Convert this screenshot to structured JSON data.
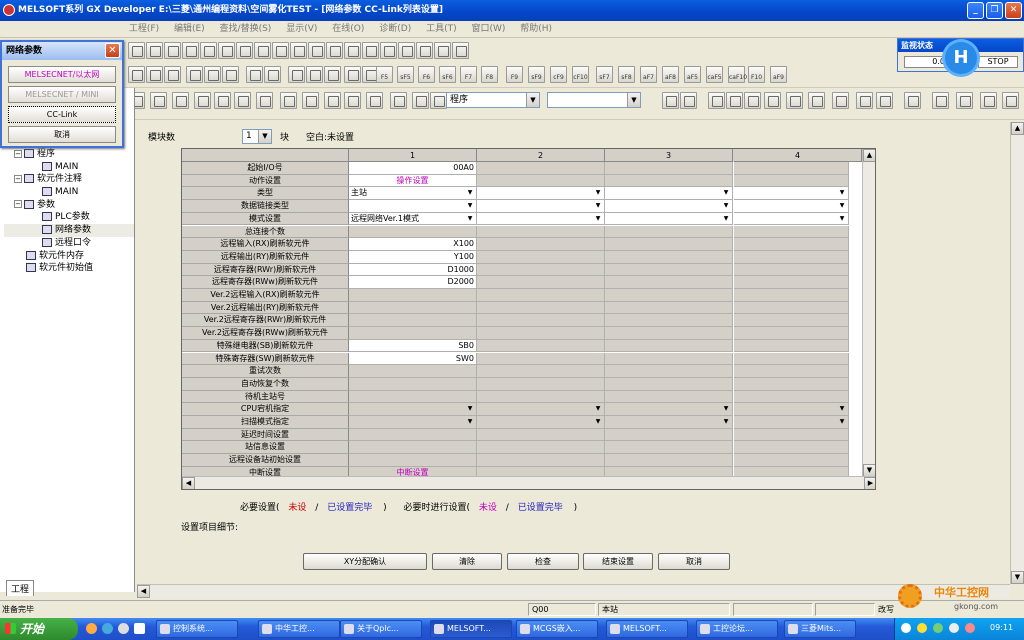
{
  "window": {
    "title": "MELSOFT系列 GX Developer E:\\三菱\\通州编程资料\\空间雾化TEST - [网络参数 CC-Link列表设置]"
  },
  "menu": [
    "工程(F)",
    "编辑(E)",
    "查找/替换(S)",
    "显示(V)",
    "在线(O)",
    "诊断(D)",
    "工具(T)",
    "窗口(W)",
    "帮助(H)"
  ],
  "toolbar": {
    "program_select": "程序",
    "second_select": ""
  },
  "fkeys": [
    "F5",
    "sF5",
    "F6",
    "sF6",
    "F7",
    "F8",
    "F9",
    "sF9",
    "cF9",
    "cF10",
    "sF7",
    "sF8",
    "aF7",
    "aF8",
    "aF5",
    "caF5",
    "caF10",
    "F10",
    "aF9"
  ],
  "network_panel": {
    "title": "网络参数",
    "buttons": [
      "MELSECNET/以太网",
      "MELSECNET / MINI",
      "CC-Link",
      "取消"
    ]
  },
  "tree": [
    {
      "label": "程序",
      "level": 1,
      "icon": "folder-icon"
    },
    {
      "label": "MAIN",
      "level": 2,
      "icon": "program-icon"
    },
    {
      "label": "软元件注释",
      "level": 1,
      "icon": "folder-icon"
    },
    {
      "label": "MAIN",
      "level": 2,
      "icon": "comment-icon"
    },
    {
      "label": "参数",
      "level": 1,
      "icon": "folder-icon"
    },
    {
      "label": "PLC参数",
      "level": 2,
      "icon": "param-icon"
    },
    {
      "label": "网络参数",
      "level": 2,
      "icon": "param-icon"
    },
    {
      "label": "远程口令",
      "level": 2,
      "icon": "param-icon"
    },
    {
      "label": "软元件内存",
      "level": 1,
      "icon": "memory-icon"
    },
    {
      "label": "软元件初始值",
      "level": 1,
      "icon": "memory-icon"
    }
  ],
  "module_count": {
    "label": "模块数",
    "value": "1",
    "unit": "块",
    "blank_label": "空白:未设置"
  },
  "grid": {
    "columns": [
      "1",
      "2",
      "3",
      "4"
    ],
    "rows": [
      {
        "label": "起始I/O号",
        "values": [
          "00A0",
          "",
          "",
          ""
        ],
        "types": [
          "w-r",
          "g",
          "g",
          "g"
        ]
      },
      {
        "label": "动作设置",
        "values": [
          "操作设置",
          "",
          "",
          ""
        ],
        "types": [
          "w-c-link",
          "g",
          "g",
          "g"
        ]
      },
      {
        "label": "类型",
        "values": [
          "主站",
          "",
          "",
          ""
        ],
        "types": [
          "w-dd",
          "w-dd",
          "w-dd",
          "w-dd"
        ]
      },
      {
        "label": "数据链接类型",
        "values": [
          "",
          "",
          "",
          ""
        ],
        "types": [
          "w-dd",
          "w-dd",
          "w-dd",
          "w-dd"
        ]
      },
      {
        "label": "模式设置",
        "values": [
          "远程网络Ver.1模式",
          "",
          "",
          ""
        ],
        "types": [
          "w-dd",
          "w-dd",
          "w-dd",
          "w-dd"
        ]
      },
      {
        "label": "总连接个数",
        "values": [
          "",
          "",
          "",
          ""
        ],
        "types": [
          "g",
          "g",
          "g",
          "g"
        ]
      },
      {
        "label": "远程输入(RX)刷新软元件",
        "values": [
          "X100",
          "",
          "",
          ""
        ],
        "types": [
          "w-r",
          "g",
          "g",
          "g"
        ]
      },
      {
        "label": "远程输出(RY)刷新软元件",
        "values": [
          "Y100",
          "",
          "",
          ""
        ],
        "types": [
          "w-r",
          "g",
          "g",
          "g"
        ]
      },
      {
        "label": "远程寄存器(RWr)刷新软元件",
        "values": [
          "D1000",
          "",
          "",
          ""
        ],
        "types": [
          "w-r",
          "g",
          "g",
          "g"
        ]
      },
      {
        "label": "远程寄存器(RWw)刷新软元件",
        "values": [
          "D2000",
          "",
          "",
          ""
        ],
        "types": [
          "w-r",
          "g",
          "g",
          "g"
        ]
      },
      {
        "label": "Ver.2远程输入(RX)刷新软元件",
        "values": [
          "",
          "",
          "",
          ""
        ],
        "types": [
          "g",
          "g",
          "g",
          "g"
        ]
      },
      {
        "label": "Ver.2远程输出(RY)刷新软元件",
        "values": [
          "",
          "",
          "",
          ""
        ],
        "types": [
          "g",
          "g",
          "g",
          "g"
        ]
      },
      {
        "label": "Ver.2远程寄存器(RWr)刷新软元件",
        "values": [
          "",
          "",
          "",
          ""
        ],
        "types": [
          "g",
          "g",
          "g",
          "g"
        ]
      },
      {
        "label": "Ver.2远程寄存器(RWw)刷新软元件",
        "values": [
          "",
          "",
          "",
          ""
        ],
        "types": [
          "g",
          "g",
          "g",
          "g"
        ]
      },
      {
        "label": "特殊继电器(SB)刷新软元件",
        "values": [
          "SB0",
          "",
          "",
          ""
        ],
        "types": [
          "w-r",
          "g",
          "g",
          "g"
        ]
      },
      {
        "label": "特殊寄存器(SW)刷新软元件",
        "values": [
          "SW0",
          "",
          "",
          ""
        ],
        "types": [
          "w-r",
          "g",
          "g",
          "g"
        ]
      },
      {
        "label": "重试次数",
        "values": [
          "",
          "",
          "",
          ""
        ],
        "types": [
          "g",
          "g",
          "g",
          "g"
        ]
      },
      {
        "label": "自动恢复个数",
        "values": [
          "",
          "",
          "",
          ""
        ],
        "types": [
          "g",
          "g",
          "g",
          "g"
        ]
      },
      {
        "label": "待机主站号",
        "values": [
          "",
          "",
          "",
          ""
        ],
        "types": [
          "g",
          "g",
          "g",
          "g"
        ]
      },
      {
        "label": "CPU宕机指定",
        "values": [
          "",
          "",
          "",
          ""
        ],
        "types": [
          "g-dd",
          "g-dd",
          "g-dd",
          "g-dd"
        ]
      },
      {
        "label": "扫描模式指定",
        "values": [
          "",
          "",
          "",
          ""
        ],
        "types": [
          "g-dd",
          "g-dd",
          "g-dd",
          "g-dd"
        ]
      },
      {
        "label": "延迟时间设置",
        "values": [
          "",
          "",
          "",
          ""
        ],
        "types": [
          "g",
          "g",
          "g",
          "g"
        ]
      },
      {
        "label": "站信息设置",
        "values": [
          "",
          "",
          "",
          ""
        ],
        "types": [
          "g",
          "g",
          "g",
          "g"
        ]
      },
      {
        "label": "远程设备站初始设置",
        "values": [
          "",
          "",
          "",
          ""
        ],
        "types": [
          "g",
          "g",
          "g",
          "g"
        ]
      },
      {
        "label": "中断设置",
        "values": [
          "中断设置",
          "",
          "",
          ""
        ],
        "types": [
          "g-c-link",
          "g",
          "g",
          "g"
        ]
      }
    ]
  },
  "legend": {
    "required_label": "必要设置(",
    "unset": "未设",
    "slash": "/",
    "done": "已设置完毕",
    "close_paren": ")",
    "optional_label": "必要时进行设置(",
    "link_color": "#c000c0",
    "unset_color": "#d00000",
    "done_color": "#2020c0"
  },
  "detail_label": "设置项目细节:",
  "buttons": [
    "XY分配确认",
    "清除",
    "检查",
    "结束设置",
    "取消"
  ],
  "status": {
    "ready": "准备完毕",
    "cpu": "Q00",
    "station": "本站",
    "mode": "改写"
  },
  "taskbar": {
    "start": "开始",
    "tasks": [
      "控制系统...",
      "中华工控...",
      "关于Qplc...",
      "MELSOFT...",
      "MCGS嵌入...",
      "MELSOFT...",
      "工控论坛...",
      "三菱Mits..."
    ],
    "clock": "09:11"
  },
  "monitor": {
    "title": "监视状态",
    "value": "0.0",
    "state": "STOP"
  },
  "badge": "H",
  "watermark": {
    "brand": "中华工控网",
    "url": "gkong.com"
  }
}
